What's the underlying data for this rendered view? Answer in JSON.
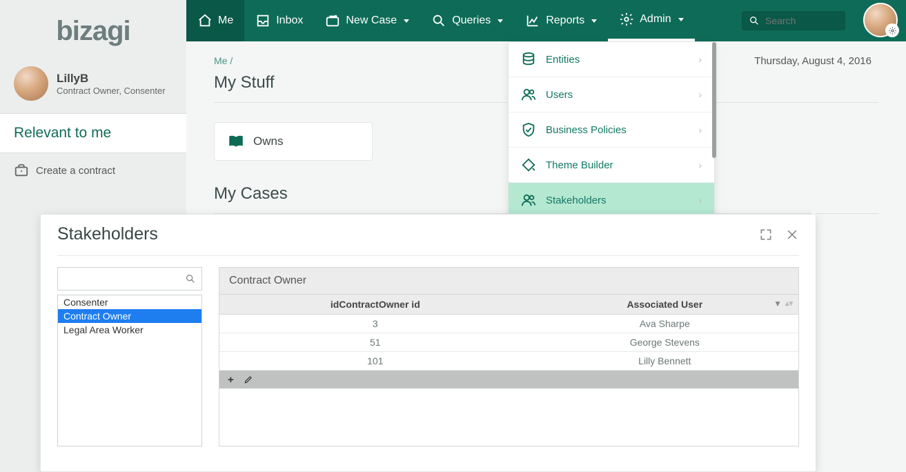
{
  "brand": "bizagi",
  "user": {
    "name": "LillyB",
    "role": "Contract Owner, Consenter"
  },
  "sidebar": {
    "relevant_label": "Relevant to me",
    "create_contract": "Create a contract"
  },
  "nav": {
    "me": "Me",
    "inbox": "Inbox",
    "newcase": "New Case",
    "queries": "Queries",
    "reports": "Reports",
    "admin": "Admin"
  },
  "search": {
    "placeholder": "Search"
  },
  "crumb": {
    "seg0": "Me",
    "sep": "/"
  },
  "sections": {
    "mystuff": "My Stuff",
    "mycases": "My Cases",
    "owns": "Owns"
  },
  "date": "Thursday, August 4, 2016",
  "admin_menu": {
    "items": [
      {
        "label": "Entities"
      },
      {
        "label": "Users"
      },
      {
        "label": "Business Policies"
      },
      {
        "label": "Theme Builder"
      },
      {
        "label": "Stakeholders"
      }
    ],
    "selected_index": 4
  },
  "panel": {
    "title": "Stakeholders",
    "roles": [
      "Consenter",
      "Contract Owner",
      "Legal Area Worker"
    ],
    "selected_role_index": 1,
    "table": {
      "title": "Contract Owner",
      "headers": [
        "idContractOwner id",
        "Associated User"
      ],
      "rows": [
        {
          "id": "3",
          "user": "Ava Sharpe"
        },
        {
          "id": "51",
          "user": "George Stevens"
        },
        {
          "id": "101",
          "user": "Lilly Bennett"
        }
      ]
    }
  }
}
